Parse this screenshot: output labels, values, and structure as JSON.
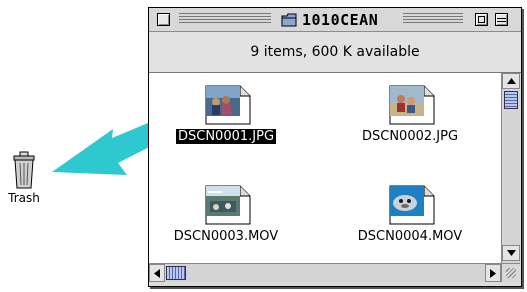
{
  "desktop": {
    "trash_label": "Trash"
  },
  "window": {
    "title": "1010CEAN",
    "info_text": "9 items, 600 K available"
  },
  "files": [
    {
      "name": "DSCN0001.JPG",
      "selected": true,
      "kind": "jpeg-thumbnail"
    },
    {
      "name": "DSCN0002.JPG",
      "selected": false,
      "kind": "jpeg-thumbnail"
    },
    {
      "name": "DSCN0003.MOV",
      "selected": false,
      "kind": "movie-thumbnail"
    },
    {
      "name": "DSCN0004.MOV",
      "selected": false,
      "kind": "movie-thumbnail"
    }
  ],
  "colors": {
    "drag_arrow": "#2ec8d0",
    "selection": "#000000",
    "scroll_thumb": "#b8c8f0"
  },
  "icons": {
    "title_folder": "folder-icon",
    "trash": "trash-icon"
  }
}
